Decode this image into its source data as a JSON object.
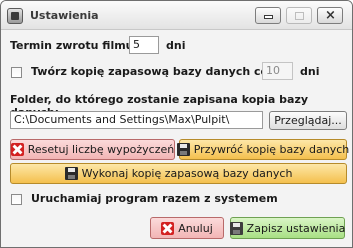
{
  "window": {
    "title": "Ustawienia"
  },
  "return_period": {
    "label": "Termin zwrotu filmu:",
    "value": "5",
    "unit": "dni"
  },
  "backup_schedule": {
    "label": "Twórz kopię zapasową bazy danych co:",
    "value": "10",
    "unit": "dni",
    "checked": false
  },
  "backup_folder": {
    "label": "Folder, do którego zostanie zapisana kopia bazy danych:",
    "path": "C:\\Documents and Settings\\Max\\Pulpit\\",
    "browse_label": "Przeglądaj..."
  },
  "actions": {
    "reset_label": "Resetuj liczbę wypożyczeń",
    "restore_label": "Przywróć kopię bazy danych",
    "backup_label": "Wykonaj kopię zapasową bazy danych"
  },
  "startup": {
    "label": "Uruchamiaj program razem z systemem",
    "checked": false
  },
  "footer": {
    "cancel_label": "Anuluj",
    "save_label": "Zapisz ustawienia"
  },
  "icons": {
    "app": "app-icon",
    "minimize": "minimize-icon",
    "maximize": "maximize-icon",
    "close": "close-icon",
    "reset": "red-x-icon",
    "restore": "floppy-disk-icon",
    "backup": "floppy-disk-icon",
    "cancel": "red-x-icon",
    "save": "floppy-disk-icon"
  },
  "colors": {
    "red_button": "#f2b5b5",
    "orange_button": "#f4c04e",
    "green_button": "#a8df84"
  }
}
